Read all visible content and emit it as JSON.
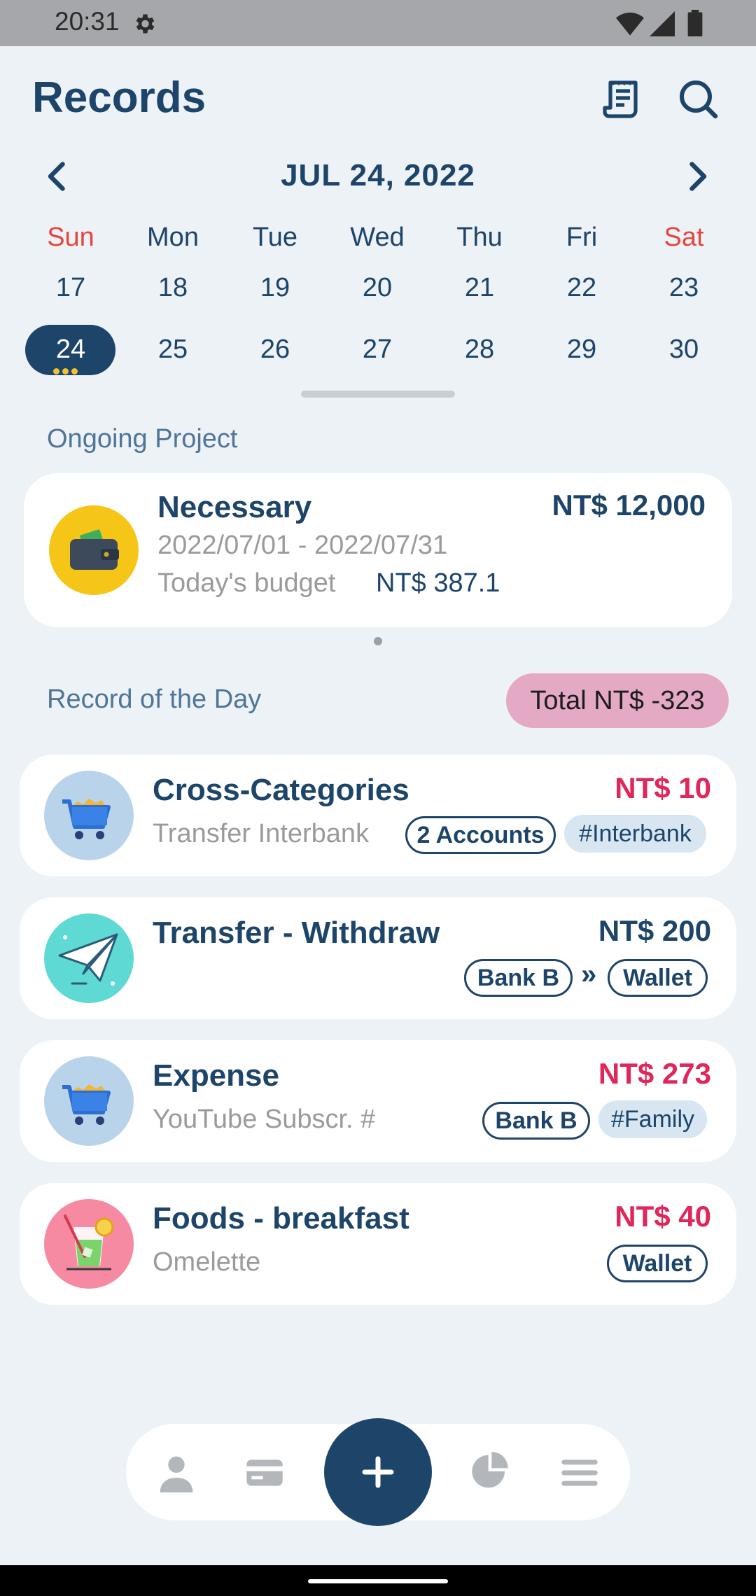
{
  "status_bar": {
    "time": "20:31",
    "icons": [
      "gear-icon",
      "wifi-icon",
      "signal-icon",
      "battery-icon"
    ]
  },
  "header": {
    "title": "Records",
    "icons": [
      "receipt-icon",
      "search-icon"
    ]
  },
  "calendar": {
    "month_label": "JUL 24, 2022",
    "weekdays": [
      "Sun",
      "Mon",
      "Tue",
      "Wed",
      "Thu",
      "Fri",
      "Sat"
    ],
    "week1": [
      "17",
      "18",
      "19",
      "20",
      "21",
      "22",
      "23"
    ],
    "week2": [
      "24",
      "25",
      "26",
      "27",
      "28",
      "29",
      "30"
    ],
    "selected_day": "24",
    "weekend_color": "#e5453f",
    "accent": "#1d4469"
  },
  "ongoing": {
    "label": "Ongoing Project",
    "project": {
      "name": "Necessary",
      "amount": "NT$ 12,000",
      "dates": "2022/07/01 - 2022/07/31",
      "budget_label": "Today's budget",
      "budget_value": "NT$ 387.1",
      "icon": "wallet-icon"
    }
  },
  "day_records": {
    "label": "Record of the Day",
    "total": "Total NT$ -323",
    "items": [
      {
        "title": "Cross-Categories",
        "amount": "NT$ 10",
        "sub": "Transfer Interbank",
        "tag1": "2 Accounts",
        "tag2": "#Interbank",
        "icon": "cart-icon"
      },
      {
        "title": "Transfer - Withdraw",
        "amount": "NT$ 200",
        "from": "Bank B",
        "arrow": "»",
        "to": "Wallet",
        "icon": "paper-plane-icon"
      },
      {
        "title": "Expense",
        "amount": "NT$ 273",
        "sub": "YouTube Subscr. #",
        "tag1": "Bank B",
        "tag2": "#Family",
        "icon": "cart-icon"
      },
      {
        "title": "Foods - breakfast",
        "amount": "NT$ 40",
        "sub": "Omelette",
        "tag1": "Wallet",
        "icon": "drink-icon"
      }
    ]
  },
  "bottom_nav": {
    "fab": "+",
    "items": [
      "person-icon",
      "card-icon",
      "pie-chart-icon",
      "list-icon"
    ]
  }
}
